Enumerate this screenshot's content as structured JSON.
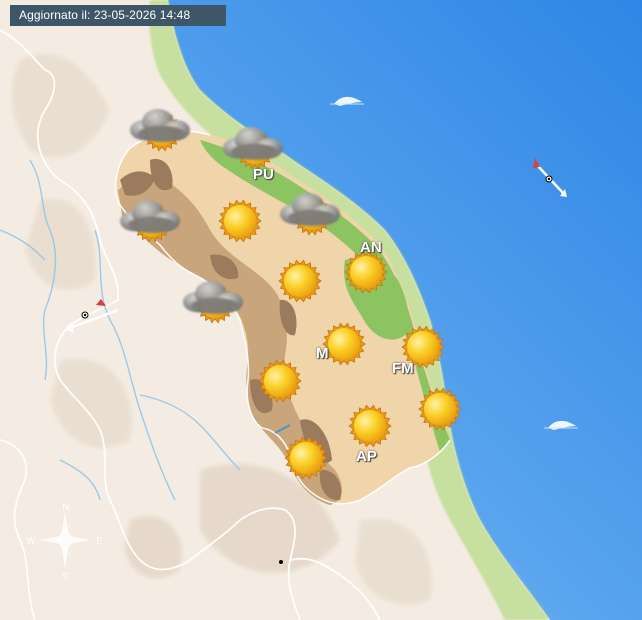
{
  "header": {
    "updated_label": "Aggiornato il: 23-05-2026 14:48"
  },
  "provinces": [
    {
      "id": "pu",
      "label": "PU"
    },
    {
      "id": "an",
      "label": "AN"
    },
    {
      "id": "mc",
      "label": "M"
    },
    {
      "id": "fm",
      "label": "FM"
    },
    {
      "id": "ap",
      "label": "AP"
    }
  ],
  "compass": {
    "n": "N",
    "s": "S",
    "e": "E",
    "w": "W"
  },
  "weather_symbols": [
    {
      "type": "cloudy-sun"
    },
    {
      "type": "cloudy-sun"
    },
    {
      "type": "cloudy-sun"
    },
    {
      "type": "cloudy-sun"
    },
    {
      "type": "cloudy-sun"
    },
    {
      "type": "sunny"
    },
    {
      "type": "sunny"
    },
    {
      "type": "sunny"
    },
    {
      "type": "sunny"
    },
    {
      "type": "sunny"
    },
    {
      "type": "sunny"
    },
    {
      "type": "sunny"
    },
    {
      "type": "sunny"
    },
    {
      "type": "sunny"
    },
    {
      "type": "sunny"
    }
  ],
  "wind_markers": [
    {
      "type": "wind-arrow-icon"
    },
    {
      "type": "wind-arrow-icon"
    }
  ],
  "sea_wave_icons": [
    {
      "type": "wave-icon"
    },
    {
      "type": "wave-icon"
    }
  ],
  "colors": {
    "sea_dark": "#2f86e6",
    "sea_light": "#bfe3fb",
    "land": "#f3eadf",
    "hills": "#edd2a6",
    "mountains": "#c9a57c",
    "high_mountains": "#9b7a5e",
    "coast_green": "#86c25f",
    "sun": "#f7c21a",
    "cloud": "#8c8c8c",
    "label_bg": "#3f5568"
  }
}
